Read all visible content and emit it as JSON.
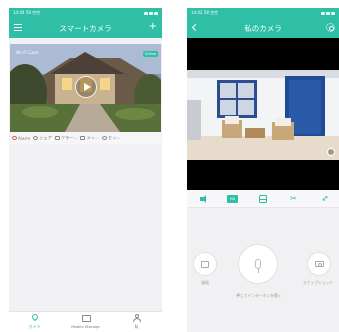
{
  "left_phone": {
    "status_bar": {
      "time": "14:04 58 空空"
    },
    "header": {
      "title": "スマートカメラ"
    },
    "camera_card": {
      "name": "Wi-Fi Cam",
      "status_badge": "Online",
      "actions": [
        {
          "label": "Alarm",
          "icon": "alarm-icon"
        },
        {
          "label": "シェア",
          "icon": "share-icon"
        },
        {
          "label": "クラー...",
          "icon": "cloud-icon"
        },
        {
          "label": "メッ...",
          "icon": "message-icon"
        },
        {
          "label": "セッ...",
          "icon": "settings-icon"
        }
      ]
    },
    "tabs": [
      {
        "label": "カメラ",
        "icon": "location-pin-icon",
        "active": true
      },
      {
        "label": "Mobile Storage",
        "icon": "picture-icon",
        "active": false
      },
      {
        "label": "私",
        "icon": "person-icon",
        "active": false
      }
    ]
  },
  "right_phone": {
    "status_bar": {
      "time": "14:02 58 空空"
    },
    "header": {
      "title": "私のカメラ"
    },
    "controls": {
      "quality_label": "HD"
    },
    "actions": {
      "left_label": "録画",
      "mic_label": "押してインターホンを聴く",
      "right_label": "スナップショット"
    }
  },
  "colors": {
    "accent": "#2fbfa7",
    "background": "#f1f1f3"
  }
}
